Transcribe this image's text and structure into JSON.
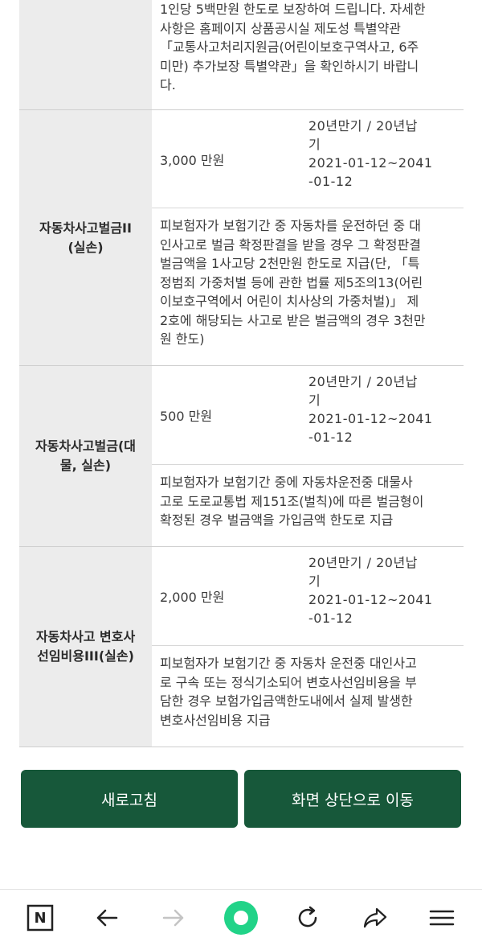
{
  "top_desc": [
    "1인당 5백만원 한도로 보장하여 드립니다. 자세한",
    "사항은 홈페이지 상품공시실 제도성 특별약관",
    "「교통사고처리지원금(어린이보호구역사고, 6주",
    "미만) 추가보장 특별약관」을 확인하시기 바랍니",
    "다."
  ],
  "rows": [
    {
      "label": [
        "자동차사고벌금II",
        "(실손)"
      ],
      "amount": "3,000 만원",
      "term": [
        "20년만기  /  20년납",
        "기",
        "2021-01-12~2041",
        "-01-12"
      ],
      "desc": [
        "피보험자가 보험기간 중 자동차를 운전하던 중 대",
        "인사고로 벌금 확정판결을 받을 경우 그 확정판결",
        "벌금액을 1사고당 2천만원 한도로 지급(단, 「특",
        "정범죄 가중처벌 등에 관한 법률 제5조의13(어린",
        "이보호구역에서 어린이 치사상의 가중처벌)」 제",
        "2호에 해당되는 사고로 받은 벌금액의 경우 3천만",
        "원 한도)"
      ]
    },
    {
      "label": [
        "자동차사고벌금(대",
        "물, 실손)"
      ],
      "amount": "500 만원",
      "term": [
        "20년만기  /  20년납",
        "기",
        "2021-01-12~2041",
        "-01-12"
      ],
      "desc": [
        "피보험자가 보험기간 중에 자동차운전중 대물사",
        "고로 도로교통법 제151조(벌칙)에 따른 벌금형이",
        "확정된 경우 벌금액을 가입금액 한도로 지급"
      ]
    },
    {
      "label": [
        "자동차사고 변호사",
        "선임비용III(실손)"
      ],
      "amount": "2,000 만원",
      "term": [
        "20년만기  /  20년납",
        "기",
        "2021-01-12~2041",
        "-01-12"
      ],
      "desc": [
        "피보험자가 보험기간 중 자동차 운전중 대인사고",
        "로 구속 또는 정식기소되어 변호사선임비용을 부",
        "담한 경우 보험가입금액한도내에서 실제 발생한",
        "변호사선임비용 지급"
      ]
    }
  ],
  "buttons": {
    "refresh": "새로고침",
    "scroll_top": "화면 상단으로 이동"
  },
  "browser_bar": {
    "logo_letter": "N"
  },
  "colors": {
    "button_bg": "#17583a",
    "label_bg": "#ececec",
    "green_accent": "#21d388"
  }
}
